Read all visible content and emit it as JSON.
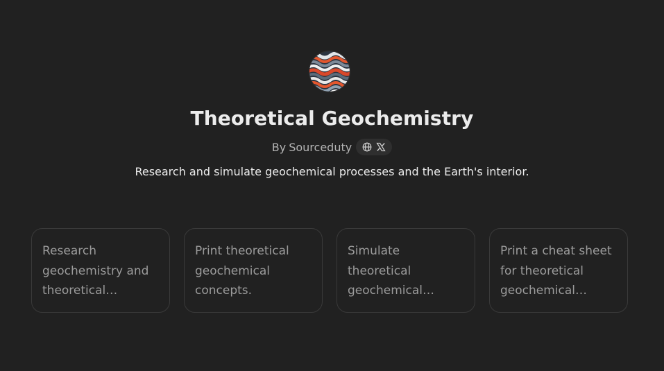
{
  "gpt": {
    "name": "Theoretical Geochemistry",
    "author_prefix": "By",
    "author": "Sourceduty",
    "description": "Research and simulate geochemical processes and the Earth's interior.",
    "link_icons": [
      "globe-icon",
      "x-logo-icon"
    ]
  },
  "conversation_starters": [
    "Research geochemistry and theoretical geochemical principles.",
    "Print theoretical geochemical concepts.",
    "Simulate theoretical geochemical processes.",
    "Print a cheat sheet for theoretical geochemical formulas."
  ],
  "colors": {
    "background": "#212121",
    "card_border": "#3a3a3a",
    "muted_text": "#9b9b9b",
    "pill_bg": "#2f2f2f"
  }
}
